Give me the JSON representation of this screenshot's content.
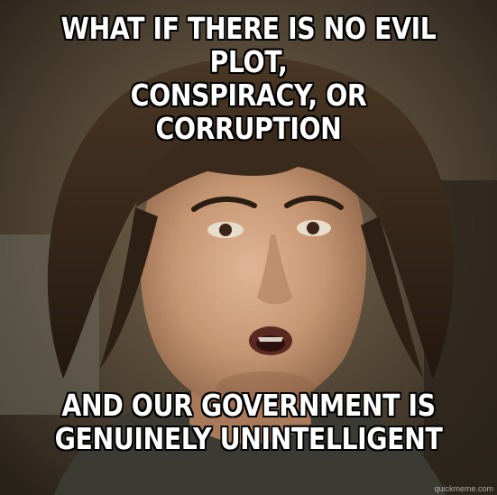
{
  "meme": {
    "top_text_line1": "WHAT IF THERE IS NO EVIL PLOT,",
    "top_text_line2": "CONSPIRACY, OR CORRUPTION",
    "bottom_text_line1": "AND OUR GOVERNMENT IS",
    "bottom_text_line2": "GENUINELY UNINTELLIGENT",
    "watermark": "quickmeme.com"
  },
  "colors": {
    "caption_text": "#ffffff",
    "caption_outline": "#000000",
    "hair": "#3b2a1c",
    "skin": "#c89a78",
    "background": "#5a4c3a"
  }
}
